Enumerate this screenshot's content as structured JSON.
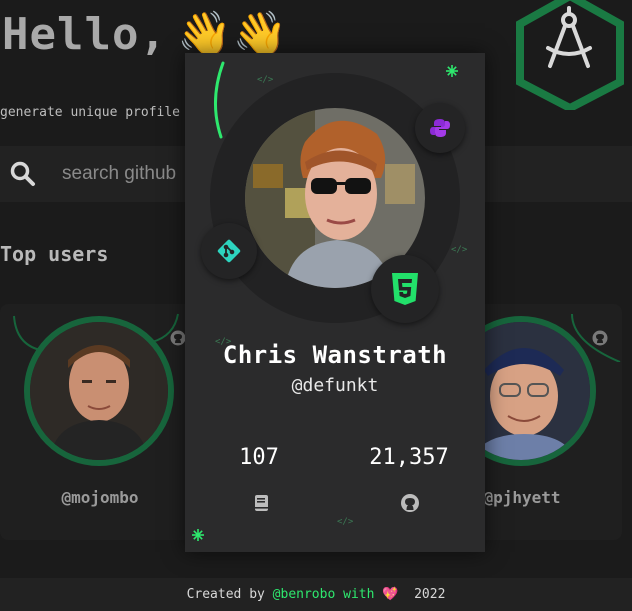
{
  "hero": {
    "title": "Hello,",
    "wave": "👋👋"
  },
  "subtitle": "generate unique profile",
  "search": {
    "placeholder": "search github"
  },
  "section_title": "Top users",
  "top_users": [
    {
      "handle": "@mojombo"
    },
    {
      "handle": "@pjhyett"
    }
  ],
  "profile": {
    "name": "Chris Wanstrath",
    "username": "@defunkt",
    "repos": "107",
    "followers": "21,357"
  },
  "footer": {
    "prefix": "Created by ",
    "author": "@benrobo",
    "with": " with ",
    "heart": "💖",
    "year": "  2022"
  },
  "colors": {
    "accent": "#2ee86e",
    "ring": "#17653c",
    "hex": "#1a7a43",
    "badge_git": "#2dd4bf",
    "badge_html": "#22e06a",
    "badge_python": "#8b2bd6"
  },
  "icons": [
    "search-icon",
    "compass-icon",
    "git-icon",
    "python-icon",
    "html5-icon",
    "book-icon",
    "github-icon",
    "sparkle-icon",
    "code-icon"
  ]
}
